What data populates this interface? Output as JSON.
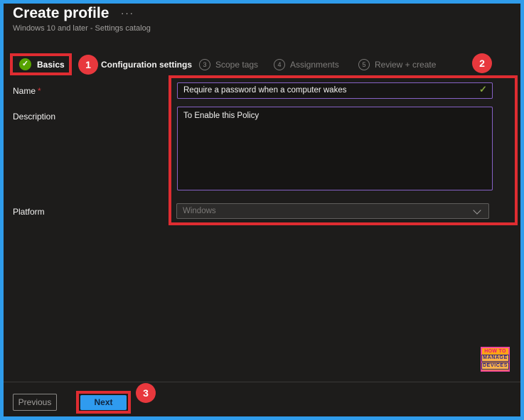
{
  "header": {
    "title": "Create profile",
    "more_options": "···",
    "subtitle": "Windows 10 and later - Settings catalog"
  },
  "steps": {
    "basics": {
      "label": "Basics",
      "check": "✓"
    },
    "configuration": {
      "label": "Configuration settings"
    },
    "others": [
      {
        "num": "3",
        "label": "Scope tags"
      },
      {
        "num": "4",
        "label": "Assignments"
      },
      {
        "num": "5",
        "label": "Review + create"
      }
    ]
  },
  "annotations": {
    "badge1": "1",
    "badge2": "2",
    "badge3": "3"
  },
  "form": {
    "name_label": "Name",
    "required_marker": "*",
    "name_value": "Require a password when a computer wakes",
    "name_valid_check": "✓",
    "description_label": "Description",
    "description_value": "To Enable this Policy",
    "platform_label": "Platform",
    "platform_value": "Windows"
  },
  "footer": {
    "previous_label": "Previous",
    "next_label": "Next"
  },
  "logo": {
    "line1": "HOW TO",
    "line2": "MANAGE",
    "line3": "DEVICES"
  },
  "colors": {
    "frame_border_blue": "#2f9ceb",
    "annotation_red": "#e8383d",
    "input_border_purple": "#8661c5",
    "success_green": "#57a300",
    "valid_check_green": "#84a33e",
    "next_button_blue": "#2f9bef",
    "background": "#1d1c1b"
  }
}
